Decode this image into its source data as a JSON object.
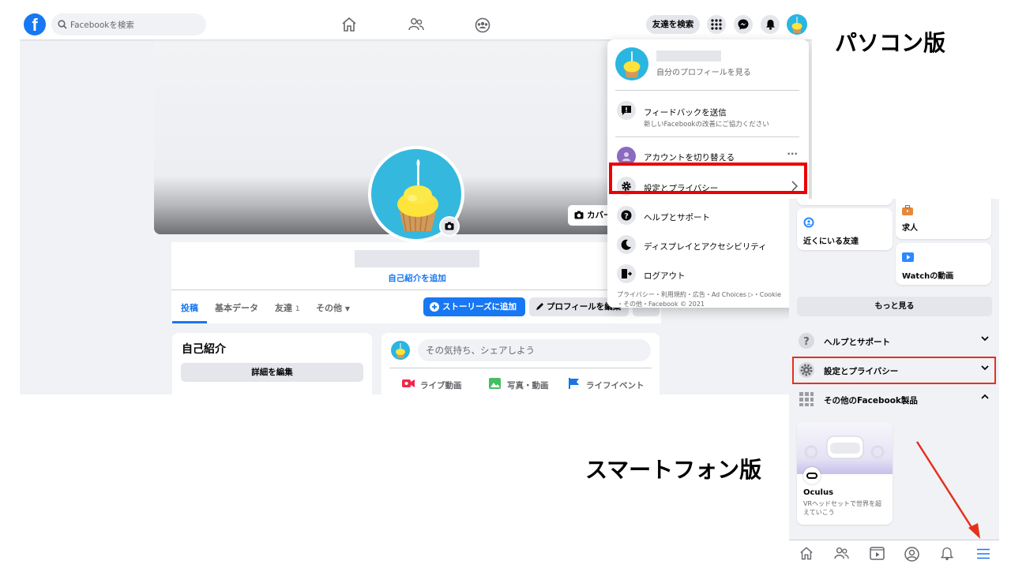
{
  "desktop": {
    "search_placeholder": "Facebookを検索",
    "logo_letter": "f",
    "find_friends_button": "友達を検索",
    "cover_button": "カバー",
    "add_bio_link": "自己紹介を追加",
    "tabs": [
      "投稿",
      "基本データ",
      "友達",
      "その他"
    ],
    "friends_count": "1",
    "stories_button": "ストーリーズに追加",
    "edit_profile_button": "プロフィールを編集",
    "intro": {
      "title": "自己紹介",
      "edit_button": "詳細を編集"
    },
    "composer": {
      "placeholder": "その気持ち、シェアしよう",
      "actions": [
        "ライブ動画",
        "写真・動画",
        "ライフイベント"
      ]
    },
    "dropdown": {
      "profile_link": "自分のプロフィールを見る",
      "feedback_title": "フィードバックを送信",
      "feedback_sub": "新しいFacebookの改善にご協力ください",
      "switch_account": "アカウントを切り替える",
      "settings_privacy": "設定とプライバシー",
      "help_support": "ヘルプとサポート",
      "display_accessibility": "ディスプレイとアクセシビリティ",
      "logout": "ログアウト",
      "footer_line1": "プライバシー・利用規約・広告・Ad Choices ▷・Cookie",
      "footer_line2": "・その他・Facebook © 2021"
    }
  },
  "labels": {
    "pc": "パソコン版",
    "smartphone": "スマートフォン版"
  },
  "mobile": {
    "shortcuts": [
      "近くにいる友達",
      "求人",
      "Watchの動画"
    ],
    "see_more": "もっと見る",
    "help_support": "ヘルプとサポート",
    "settings_privacy": "設定とプライバシー",
    "other_products": "その他のFacebook製品",
    "oculus": {
      "title": "Oculus",
      "description": "VRヘッドセットで世界を超えていこう"
    }
  },
  "colors": {
    "facebook_blue": "#1877f2",
    "highlight_red": "#ee0000",
    "arrow_red": "#e4311e"
  }
}
